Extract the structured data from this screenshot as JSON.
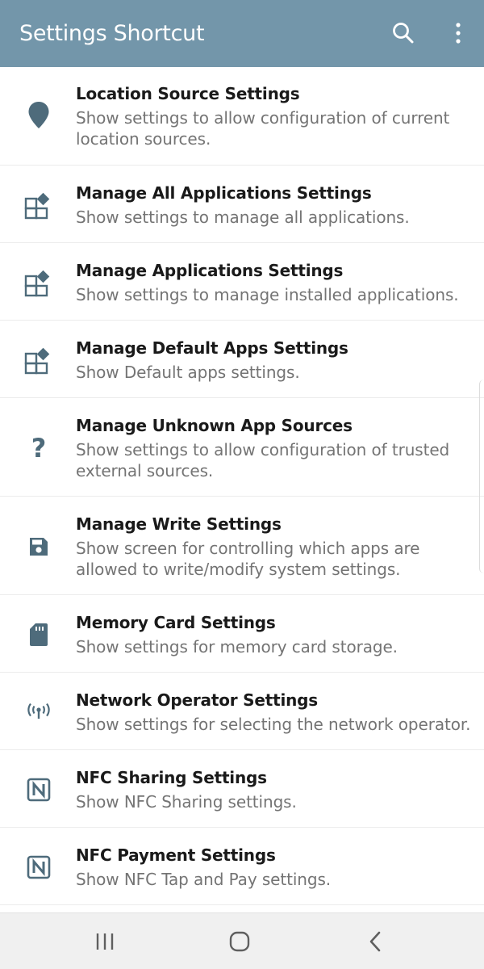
{
  "app_bar": {
    "title": "Settings Shortcut",
    "background_color": "#7396aa",
    "actions": [
      "search-icon",
      "more-vert-icon"
    ]
  },
  "items": [
    {
      "icon": "location-pin-icon",
      "title": "Location Source Settings",
      "subtitle": "Show settings to allow configuration of current location sources."
    },
    {
      "icon": "apps-grid-icon",
      "title": "Manage All Applications Settings",
      "subtitle": "Show settings to manage all applications."
    },
    {
      "icon": "apps-grid-icon",
      "title": "Manage Applications Settings",
      "subtitle": "Show settings to manage installed applications."
    },
    {
      "icon": "apps-grid-icon",
      "title": "Manage Default Apps Settings",
      "subtitle": "Show Default apps settings."
    },
    {
      "icon": "question-mark-icon",
      "title": "Manage Unknown App Sources",
      "subtitle": "Show settings to allow configuration of trusted external sources."
    },
    {
      "icon": "save-floppy-icon",
      "title": "Manage Write Settings",
      "subtitle": "Show screen for controlling which apps are allowed to write/modify system settings."
    },
    {
      "icon": "sd-card-icon",
      "title": "Memory Card Settings",
      "subtitle": "Show settings for memory card storage."
    },
    {
      "icon": "antenna-signal-icon",
      "title": "Network Operator Settings",
      "subtitle": "Show settings for selecting the network operator."
    },
    {
      "icon": "nfc-icon",
      "title": "NFC Sharing Settings",
      "subtitle": "Show NFC Sharing settings."
    },
    {
      "icon": "nfc-icon",
      "title": "NFC Payment Settings",
      "subtitle": "Show NFC Tap and Pay settings."
    }
  ],
  "nav_bar": {
    "buttons": [
      "recent-apps-icon",
      "home-icon",
      "back-icon"
    ]
  }
}
